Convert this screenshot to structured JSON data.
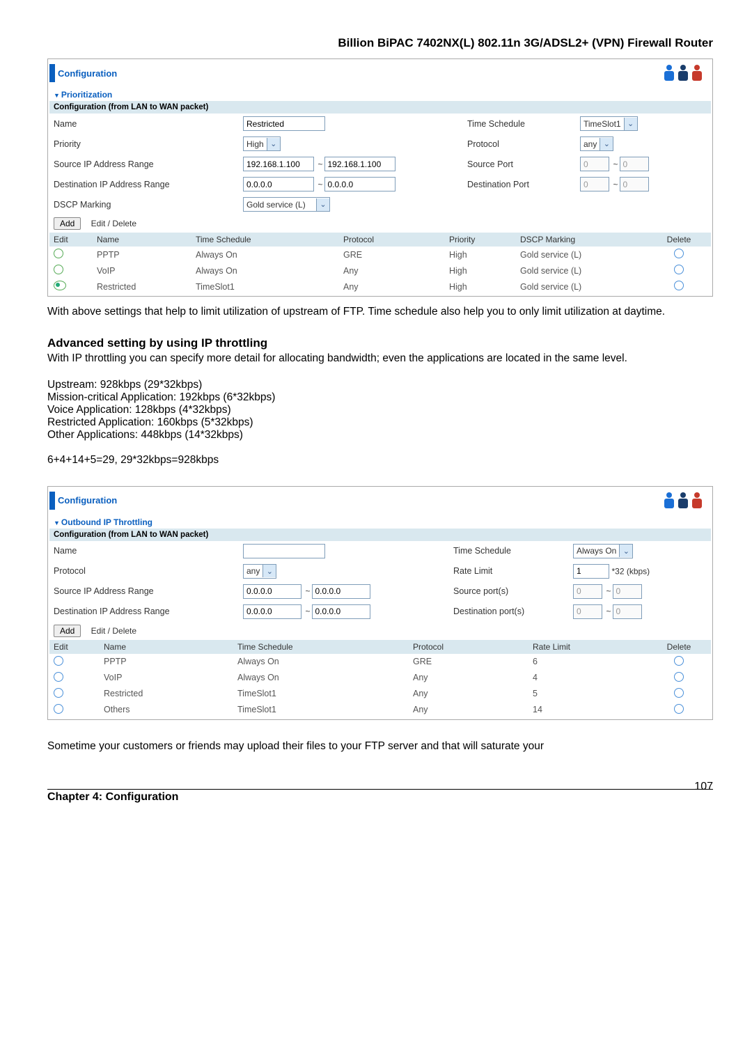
{
  "page": {
    "header": "Billion BiPAC 7402NX(L) 802.11n 3G/ADSL2+ (VPN) Firewall Router",
    "number": "107",
    "chapter": "Chapter 4: Configuration"
  },
  "panel1": {
    "title": "Configuration",
    "section": "Prioritization",
    "subtitle": "Configuration (from LAN to WAN packet)",
    "form": {
      "name_lbl": "Name",
      "name_val": "Restricted",
      "tsched_lbl": "Time Schedule",
      "tsched_val": "TimeSlot1",
      "prio_lbl": "Priority",
      "prio_val": "High",
      "proto_lbl": "Protocol",
      "proto_val": "any",
      "src_lbl": "Source IP Address Range",
      "src_from": "192.168.1.100",
      "src_to": "192.168.1.100",
      "sport_lbl": "Source Port",
      "sport_from": "0",
      "sport_to": "0",
      "dst_lbl": "Destination IP Address Range",
      "dst_from": "0.0.0.0",
      "dst_to": "0.0.0.0",
      "dport_lbl": "Destination Port",
      "dport_from": "0",
      "dport_to": "0",
      "dscp_lbl": "DSCP Marking",
      "dscp_val": "Gold service (L)"
    },
    "add_btn": "Add",
    "edit_delete": "Edit / Delete",
    "cols": {
      "c1": "Edit",
      "c2": "Name",
      "c3": "Time Schedule",
      "c4": "Protocol",
      "c5": "Priority",
      "c6": "DSCP Marking",
      "c7": "Delete"
    },
    "rows": [
      {
        "sel": false,
        "name": "PPTP",
        "ts": "Always On",
        "proto": "GRE",
        "prio": "High",
        "dscp": "Gold service (L)"
      },
      {
        "sel": false,
        "name": "VoIP",
        "ts": "Always On",
        "proto": "Any",
        "prio": "High",
        "dscp": "Gold service (L)"
      },
      {
        "sel": true,
        "name": "Restricted",
        "ts": "TimeSlot1",
        "proto": "Any",
        "prio": "High",
        "dscp": "Gold service (L)"
      }
    ]
  },
  "text1": "With above settings that help to limit utilization of upstream of FTP. Time schedule also help you to only limit utilization at daytime.",
  "heading2": "Advanced setting by using IP throttling",
  "text2": "With IP throttling you can specify more detail for allocating bandwidth; even the applications are located in the same level.",
  "lines": {
    "l1": "Upstream: 928kbps (29*32kbps)",
    "l2": "Mission-critical Application: 192kbps (6*32kbps)",
    "l3": "Voice Application: 128kbps (4*32kbps)",
    "l4": "Restricted Application: 160kbps (5*32kbps)",
    "l5": "Other Applications: 448kbps (14*32kbps)",
    "l6": "6+4+14+5=29, 29*32kbps=928kbps"
  },
  "panel2": {
    "title": "Configuration",
    "section": "Outbound IP Throttling",
    "subtitle": "Configuration (from LAN to WAN packet)",
    "form": {
      "name_lbl": "Name",
      "name_val": "",
      "tsched_lbl": "Time Schedule",
      "tsched_val": "Always On",
      "proto_lbl": "Protocol",
      "proto_val": "any",
      "rate_lbl": "Rate Limit",
      "rate_val": "1",
      "rate_unit": "*32 (kbps)",
      "src_lbl": "Source IP Address Range",
      "src_from": "0.0.0.0",
      "src_to": "0.0.0.0",
      "sport_lbl": "Source port(s)",
      "sport_from": "0",
      "sport_to": "0",
      "dst_lbl": "Destination IP Address Range",
      "dst_from": "0.0.0.0",
      "dst_to": "0.0.0.0",
      "dport_lbl": "Destination port(s)",
      "dport_from": "0",
      "dport_to": "0"
    },
    "add_btn": "Add",
    "edit_delete": "Edit / Delete",
    "cols": {
      "c1": "Edit",
      "c2": "Name",
      "c3": "Time Schedule",
      "c4": "Protocol",
      "c5": "Rate Limit",
      "c6": "Delete"
    },
    "rows": [
      {
        "name": "PPTP",
        "ts": "Always On",
        "proto": "GRE",
        "rate": "6"
      },
      {
        "name": "VoIP",
        "ts": "Always On",
        "proto": "Any",
        "rate": "4"
      },
      {
        "name": "Restricted",
        "ts": "TimeSlot1",
        "proto": "Any",
        "rate": "5"
      },
      {
        "name": "Others",
        "ts": "TimeSlot1",
        "proto": "Any",
        "rate": "14"
      }
    ]
  },
  "text3": "Sometime your customers or friends may upload their files to your FTP server and that will saturate your",
  "chart_data": null
}
